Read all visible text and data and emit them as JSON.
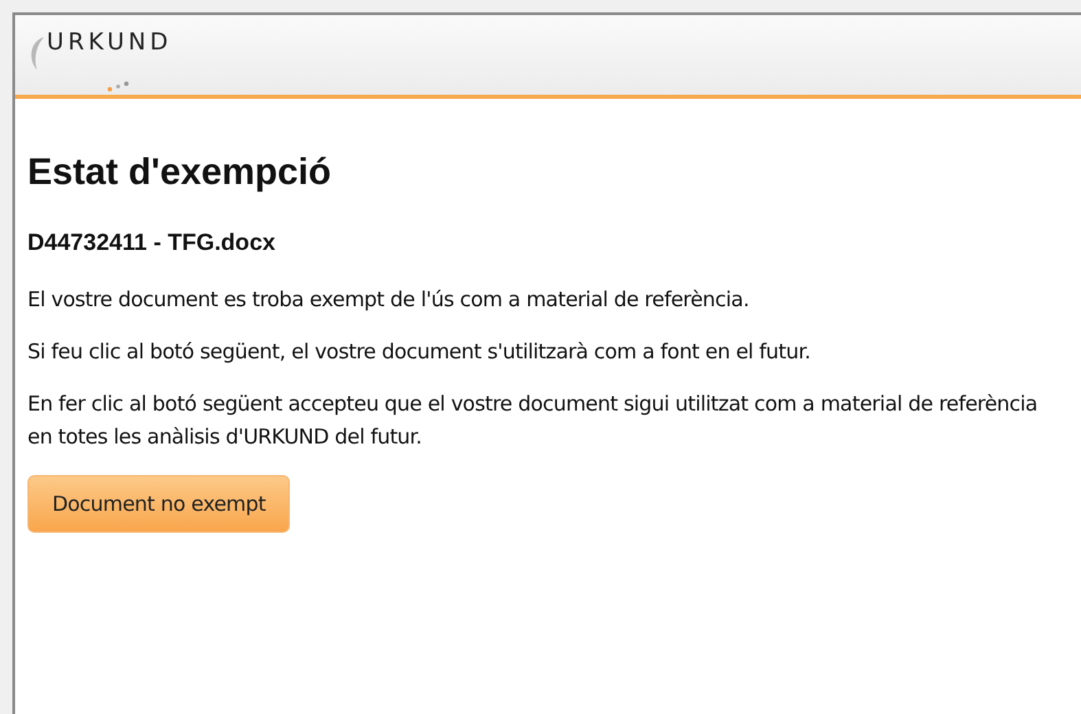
{
  "header": {
    "logo": "URKUND"
  },
  "title": "Estat d'exempció",
  "document": "D44732411 - TFG.docx",
  "paragraphs": [
    "El vostre document es troba exempt de l'ús com a material de referència.",
    "Si feu clic al botó següent, el vostre document s'utilitzarà com a font en el futur.",
    "En fer clic al botó següent accepteu que el vostre document sigui utilitzat com a material de referència en totes les anàlisis d'URKUND del futur."
  ],
  "button": "Document no exempt"
}
